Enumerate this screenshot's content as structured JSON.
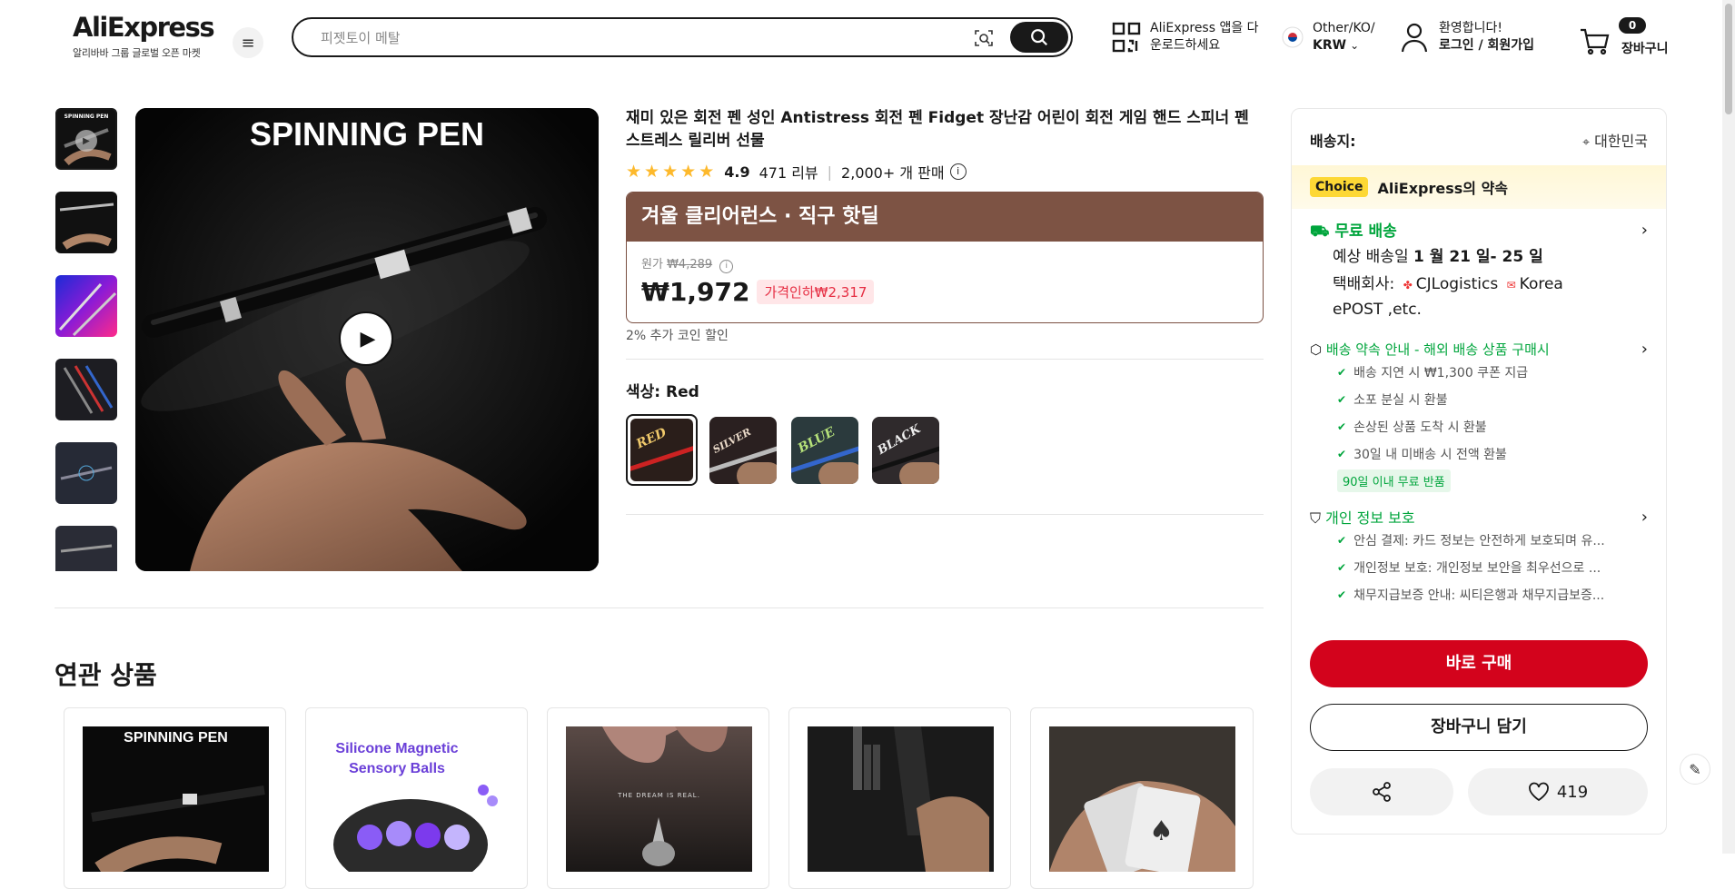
{
  "header": {
    "logo_text": "AliExpress",
    "logo_sub": "알리바바 그룹 글로벌 오픈 마켓",
    "search_placeholder": "피젯토이 메탈",
    "app_line1": "AliExpress 앱을 다",
    "app_line2": "운로드하세요",
    "locale_line1": "Other/KO/",
    "locale_line2": "KRW",
    "welcome_line1": "환영합니다!",
    "welcome_line2": "로그인 / 회원가입",
    "cart_count": "0",
    "cart_label": "장바구니"
  },
  "gallery": {
    "main_caption": "SPINNING PEN",
    "thumb_caption": "SPINNING PEN"
  },
  "product": {
    "title": "재미 있은 회전 펜 성인 Antistress 회전 펜 Fidget 장난감 어린이 회전 게임 핸드 스피너 펜 스트레스 릴리버 선물",
    "rating": "4.9",
    "reviews": "471 리뷰",
    "sold": "2,000+ 개 판매",
    "promo_banner": "겨울 클리어런스 · 직구 핫딜",
    "original_label": "원가",
    "original_price": "₩4,289",
    "price": "₩1,972",
    "discount_badge": "가격인하₩2,317",
    "coin_discount": "2% 추가 코인 할인",
    "color_label": "색상:",
    "color_value": "Red",
    "swatches": [
      "RED",
      "SILVER",
      "BLUE",
      "BLACK"
    ]
  },
  "panel": {
    "ship_to_label": "배송지:",
    "ship_to_value": "대한민국",
    "choice_badge": "Choice",
    "choice_text": "AliExpress의 약속",
    "free_shipping": "무료 배송",
    "delivery_prefix": "예상 배송일",
    "delivery_dates": "1 월 21 일- 25 일",
    "courier_label": "택배회사:",
    "courier1": "CJLogistics",
    "courier2": "Korea",
    "courier3": "ePOST ,etc.",
    "promise_title": "배송 약속 안내 - 해외 배송 상품 구매시",
    "promise_items": [
      "배송 지연 시 ₩1,300 쿠폰 지급",
      "소포 분실 시 환불",
      "손상된 상품 도착 시 환불",
      "30일 내 미배송 시 전액 환불"
    ],
    "return_badge": "90일 이내 무료 반품",
    "privacy_title": "개인 정보 보호",
    "privacy_items": [
      "안심 결제: 카드 정보는 안전하게 보호되며 유...",
      "개인정보 보호: 개인정보 보안을 최우선으로 ...",
      "채무지급보증 안내: 씨티은행과 채무지급보증..."
    ],
    "buy_now": "바로 구매",
    "add_to_cart": "장바구니 담기",
    "wishlist_count": "419"
  },
  "related": {
    "heading": "연관 상품",
    "card1_caption": "SPINNING PEN",
    "card2_caption_line1": "Silicone Magnetic",
    "card2_caption_line2": "Sensory Balls",
    "card3_caption": "THE DREAM IS REAL."
  },
  "colors": {
    "accent_red": "#d3031c",
    "promo_brown": "#7d5344",
    "choice_yellow": "#fdd835",
    "green": "#00a53c",
    "star": "#fdb92c"
  }
}
